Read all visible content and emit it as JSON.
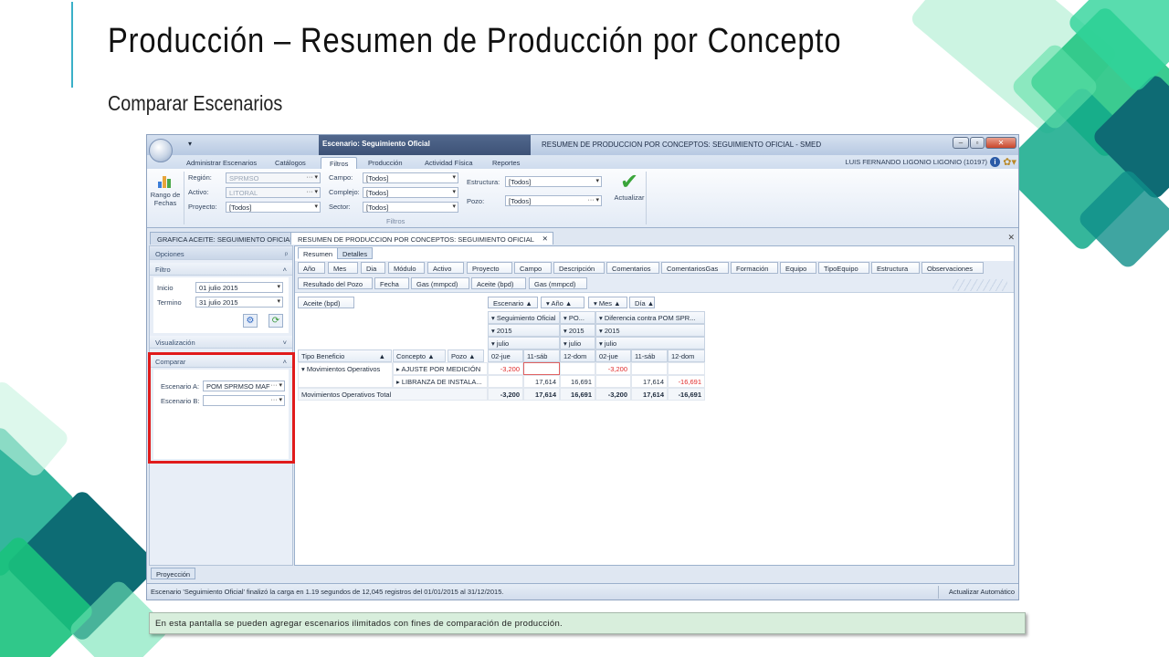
{
  "slide": {
    "title": "Producción – Resumen de Producción por Concepto",
    "subtitle": "Comparar Escenarios",
    "caption": "En esta pantalla se pueden agregar escenarios ilimitados con fines de comparación de producción."
  },
  "window": {
    "context_tab": "Escenario: Seguimiento Oficial",
    "title": "RESUMEN DE PRODUCCION POR CONCEPTOS: SEGUIMIENTO OFICIAL - SMED",
    "user": "LUIS FERNANDO LIGONIO LIGONIO (10197)",
    "ribbon_tabs": [
      "Administrar Escenarios",
      "Catálogos",
      "Filtros",
      "Producción",
      "Actividad Física",
      "Reportes"
    ],
    "active_ribbon_tab": "Filtros"
  },
  "ribbon": {
    "rango_label": "Rango de Fechas",
    "region_label": "Región:",
    "region_value": "SPRMSO",
    "activo_label": "Activo:",
    "activo_value": "LITORAL",
    "proyecto_label": "Proyecto:",
    "proyecto_value": "[Todos]",
    "campo_label": "Campo:",
    "campo_value": "[Todos]",
    "complejo_label": "Complejo:",
    "complejo_value": "[Todos]",
    "sector_label": "Sector:",
    "sector_value": "[Todos]",
    "estructura_label": "Estructura:",
    "estructura_value": "[Todos]",
    "pozo_label": "Pozo:",
    "pozo_value": "[Todos]",
    "actualizar_label": "Actualizar",
    "group_label": "Filtros"
  },
  "doc_tabs": [
    "GRAFICA ACEITE: SEGUIMIENTO OFICIAL",
    "RESUMEN DE PRODUCCION POR CONCEPTOS: SEGUIMIENTO OFICIAL"
  ],
  "options_panel": {
    "header": "Opciones",
    "filtro_header": "Filtro",
    "inicio_label": "Inicio",
    "inicio_value": "01 julio 2015",
    "termino_label": "Termino",
    "termino_value": "31 julio 2015",
    "visualizacion_header": "Visualización",
    "comparar_header": "Comparar",
    "escenario_a_label": "Escenario A:",
    "escenario_a_value": "POM SPRMSO MAF",
    "escenario_b_label": "Escenario B:",
    "escenario_b_value": ""
  },
  "subtabs": [
    "Resumen",
    "Detalles"
  ],
  "field_chips_row1": [
    "Año",
    "Mes",
    "Dia",
    "Módulo",
    "Activo",
    "Proyecto",
    "Campo",
    "Descripción",
    "Comentarios",
    "ComentariosGas",
    "Formación",
    "Equipo",
    "TipoEquipo",
    "Estructura",
    "Observaciones"
  ],
  "field_chips_row2": [
    "Resultado del Pozo",
    "Fecha",
    "Gas (mmpcd)",
    "Aceite (bpd)",
    "Gas (mmpcd)"
  ],
  "data_field": "Aceite (bpd)",
  "col_fields": [
    "Escenario ▲",
    "Año ▲",
    "Mes ▲",
    "Día ▲"
  ],
  "row_fields": [
    "Tipo Beneficio",
    "Concepto ▲",
    "Pozo ▲"
  ],
  "pivot": {
    "scenarios": [
      "Seguimiento Oficial",
      "PO...",
      "Diferencia contra POM SPR..."
    ],
    "year": "2015",
    "month": "julio",
    "days": [
      "02-jue",
      "11-sáb",
      "12-dom",
      "02-jue",
      "11-sáb",
      "12-dom"
    ],
    "group": "Movimientos Operativos",
    "rows": [
      {
        "concepto": "AJUSTE POR MEDICIÓN",
        "values": [
          "-3,200",
          "",
          "",
          "-3,200",
          "",
          ""
        ]
      },
      {
        "concepto": "LIBRANZA DE INSTALA...",
        "values": [
          "",
          "17,614",
          "16,691",
          "",
          "17,614",
          "-16,691"
        ]
      }
    ],
    "total_label": "Movimientos Operativos Total",
    "totals": [
      "-3,200",
      "17,614",
      "16,691",
      "-3,200",
      "17,614",
      "-16,691"
    ]
  },
  "bottom_tab": "Proyección",
  "status": {
    "message": "Escenario 'Seguimiento Oficial' finalizó la carga en 1.19 segundos de 12,045 registros del 01/01/2015 al 31/12/2015.",
    "right": "Actualizar Automático"
  },
  "colors": {
    "accent": "#3ab0c8",
    "highlight": "#e01b1b",
    "green": "#20c070"
  }
}
